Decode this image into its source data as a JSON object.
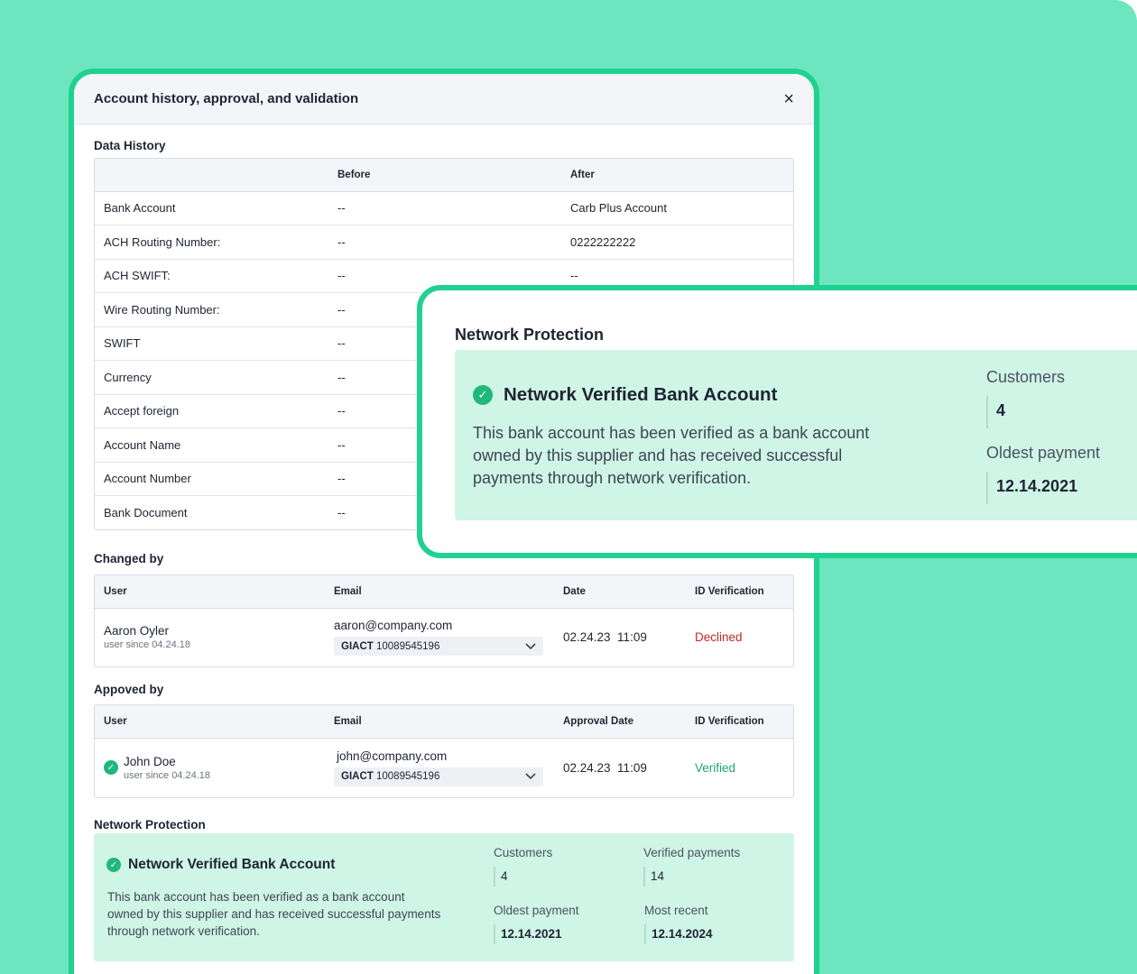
{
  "modal": {
    "title": "Account history, approval, and validation",
    "close_icon": "×"
  },
  "data_history": {
    "title": "Data History",
    "columns": [
      "",
      "Before",
      "After"
    ],
    "rows": [
      {
        "field": "Bank Account",
        "before": "--",
        "after": "Carb Plus Account"
      },
      {
        "field": "ACH Routing Number:",
        "before": "--",
        "after": "0222222222"
      },
      {
        "field": "ACH SWIFT:",
        "before": "--",
        "after": "--"
      },
      {
        "field": "Wire Routing Number:",
        "before": "--",
        "after": ""
      },
      {
        "field": "SWIFT",
        "before": "--",
        "after": ""
      },
      {
        "field": "Currency",
        "before": "--",
        "after": ""
      },
      {
        "field": "Accept foreign",
        "before": "--",
        "after": ""
      },
      {
        "field": "Account Name",
        "before": "--",
        "after": ""
      },
      {
        "field": "Account Number",
        "before": "--",
        "after": ""
      },
      {
        "field": "Bank Document",
        "before": "--",
        "after": ""
      }
    ]
  },
  "changed_by": {
    "title": "Changed by",
    "columns": [
      "User",
      "Email",
      "Date",
      "ID Verification"
    ],
    "row": {
      "user": "Aaron Oyler",
      "user_since": "user since 04.24.18",
      "email": "aaron@company.com",
      "giact_label": "GIACT",
      "giact_id": "10089545196",
      "date": "02.24.23  11:09",
      "verification": "Declined"
    }
  },
  "approved_by": {
    "title": "Appoved by",
    "columns": [
      "User",
      "Email",
      "Approval Date",
      "ID Verification"
    ],
    "row": {
      "user": "John Doe",
      "user_since": "user since 04.24.18",
      "email": "john@company.com",
      "giact_label": "GIACT",
      "giact_id": "10089545196",
      "date": "02.24.23  11:09",
      "verification": "Verified"
    }
  },
  "network_protection": {
    "title": "Network Protection",
    "heading": "Network Verified Bank Account",
    "description": "This bank account has been verified as a bank account owned by this supplier and has received successful payments through network verification.",
    "stats": {
      "customers_label": "Customers",
      "customers": "4",
      "verified_payments_label": "Verified payments",
      "verified_payments": "14",
      "oldest_label": "Oldest payment",
      "oldest": "12.14.2021",
      "recent_label": "Most recent",
      "recent": "12.14.2024"
    }
  },
  "overlay": {
    "title": "Network Protection",
    "heading": "Network Verified Bank Account",
    "description": "This bank account has been verified as a bank account owned by this supplier and has received successful payments through network verification.",
    "customers_label": "Customers",
    "customers": "4",
    "oldest_label": "Oldest payment",
    "oldest": "12.14.2021"
  },
  "colors": {
    "background": "#6de6bf",
    "accent_border": "#1fd28f",
    "verified_panel": "#cff5e6",
    "declined": "#c62828",
    "verified": "#1aa86b"
  },
  "icons": {
    "check": "✓",
    "chevron": "⌄"
  }
}
